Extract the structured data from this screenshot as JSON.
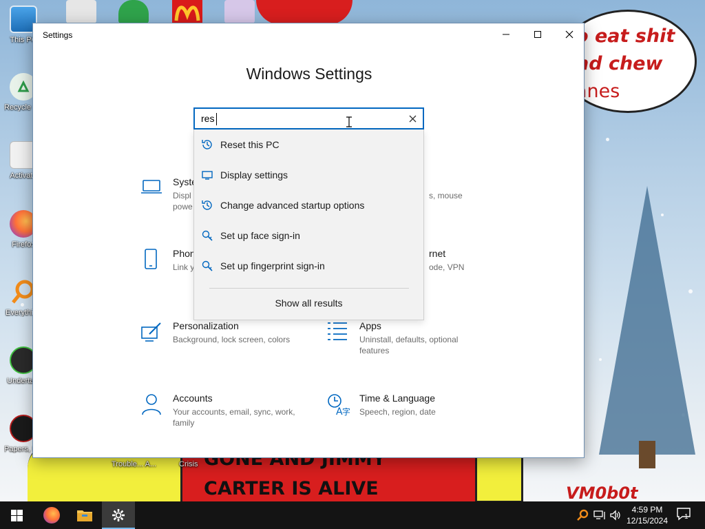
{
  "wallpaper": {
    "bubble_lines": [
      "o eat shit",
      "nd chew",
      "anes"
    ],
    "banner_lines": [
      "GONE AND JIMMY",
      "CARTER IS ALIVE"
    ],
    "signature": "VM0b0t"
  },
  "desktop_icons": [
    {
      "label": "This PC",
      "icon": "this-pc-icon"
    },
    {
      "label": "Recycle Bin",
      "icon": "recycle-bin-icon"
    },
    {
      "label": "Activate",
      "icon": "activate-icon"
    },
    {
      "label": "Firefox",
      "icon": "firefox-icon"
    },
    {
      "label": "Everything",
      "icon": "everything-icon"
    },
    {
      "label": "Undertale",
      "icon": "undertale-icon"
    },
    {
      "label": "Papers, Please",
      "icon": "papers-please-icon"
    }
  ],
  "desktop_bottom_labels": [
    "Trouble... A...",
    "Crisis"
  ],
  "window": {
    "title": "Settings",
    "heading": "Windows Settings",
    "controls": {
      "minimize": "minimize-icon",
      "maximize": "maximize-icon",
      "close": "close-icon"
    }
  },
  "search": {
    "value": "res",
    "suggestions": [
      {
        "label": "Reset this PC",
        "icon": "history-icon"
      },
      {
        "label": "Display settings",
        "icon": "monitor-icon"
      },
      {
        "label": "Change advanced startup options",
        "icon": "history-icon"
      },
      {
        "label": "Set up face sign-in",
        "icon": "key-search-icon"
      },
      {
        "label": "Set up fingerprint sign-in",
        "icon": "key-search-icon"
      }
    ],
    "show_all": "Show all results"
  },
  "categories": [
    {
      "name": "Syste",
      "desc": "Displ\npowe",
      "icon": "laptop-icon"
    },
    {
      "name": "",
      "desc": "s, mouse",
      "icon": ""
    },
    {
      "name": "Phon",
      "desc": "Link y",
      "icon": "phone-icon"
    },
    {
      "name": "rnet",
      "desc": "ode, VPN",
      "icon": ""
    },
    {
      "name": "Personalization",
      "desc": "Background, lock screen, colors",
      "icon": "personalization-icon"
    },
    {
      "name": "Apps",
      "desc": "Uninstall, defaults, optional features",
      "icon": "apps-icon"
    },
    {
      "name": "Accounts",
      "desc": "Your accounts, email, sync, work, family",
      "icon": "accounts-icon"
    },
    {
      "name": "Time & Language",
      "desc": "Speech, region, date",
      "icon": "time-language-icon"
    }
  ],
  "taskbar": {
    "apps": [
      "start-icon",
      "firefox-icon",
      "file-explorer-icon",
      "settings-icon"
    ],
    "tray": [
      "search-tray-icon",
      "network-icon",
      "volume-icon"
    ],
    "time": "4:59 PM",
    "date": "12/15/2024",
    "notification_count": "1"
  },
  "colors": {
    "accent": "#0067c0",
    "taskbar": "#141414",
    "active_app": "#3b3b3b"
  }
}
